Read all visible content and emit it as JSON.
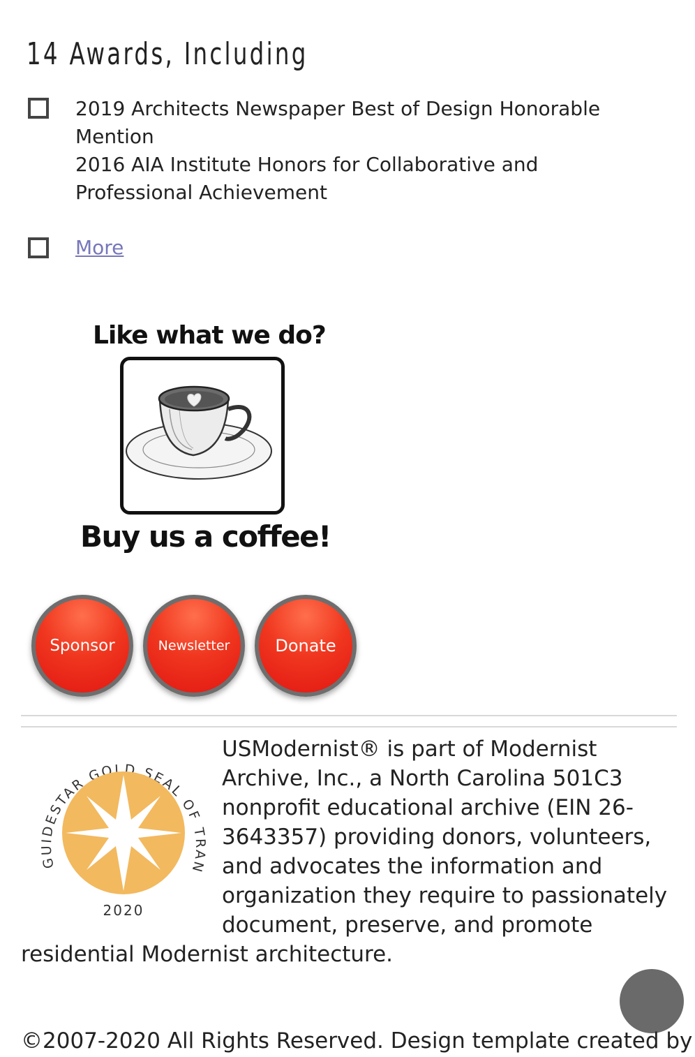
{
  "awards": {
    "heading": "14 Awards, Including",
    "items": [
      "2019 Architects Newspaper Best of Design Honorable Mention",
      "2016 AIA Institute Honors for Collaborative and Professional Achievement"
    ],
    "more_label": "More"
  },
  "coffee": {
    "top_text": "Like what we do?",
    "bottom_text": "Buy us a coffee!"
  },
  "buttons": [
    {
      "label": "Sponsor"
    },
    {
      "label": "Newsletter"
    },
    {
      "label": "Donate"
    }
  ],
  "seal": {
    "arc_text": "GUIDESTAR GOLD SEAL OF TRANSPARENCY",
    "year": "2020"
  },
  "about": {
    "text": "USModernist® is part of Modernist Archive, Inc., a North Carolina 501C3 nonprofit educational archive (EIN 26-3643357) providing donors, volunteers, and advocates the information and organization they require to passionately document, preserve, and promote residential Modernist architecture."
  },
  "footer": {
    "text": "©2007-2020 All Rights Reserved. Design template created by"
  },
  "colors": {
    "button_red": "#e8241a",
    "seal_gold": "#f2b95e",
    "link": "#7777bb"
  }
}
